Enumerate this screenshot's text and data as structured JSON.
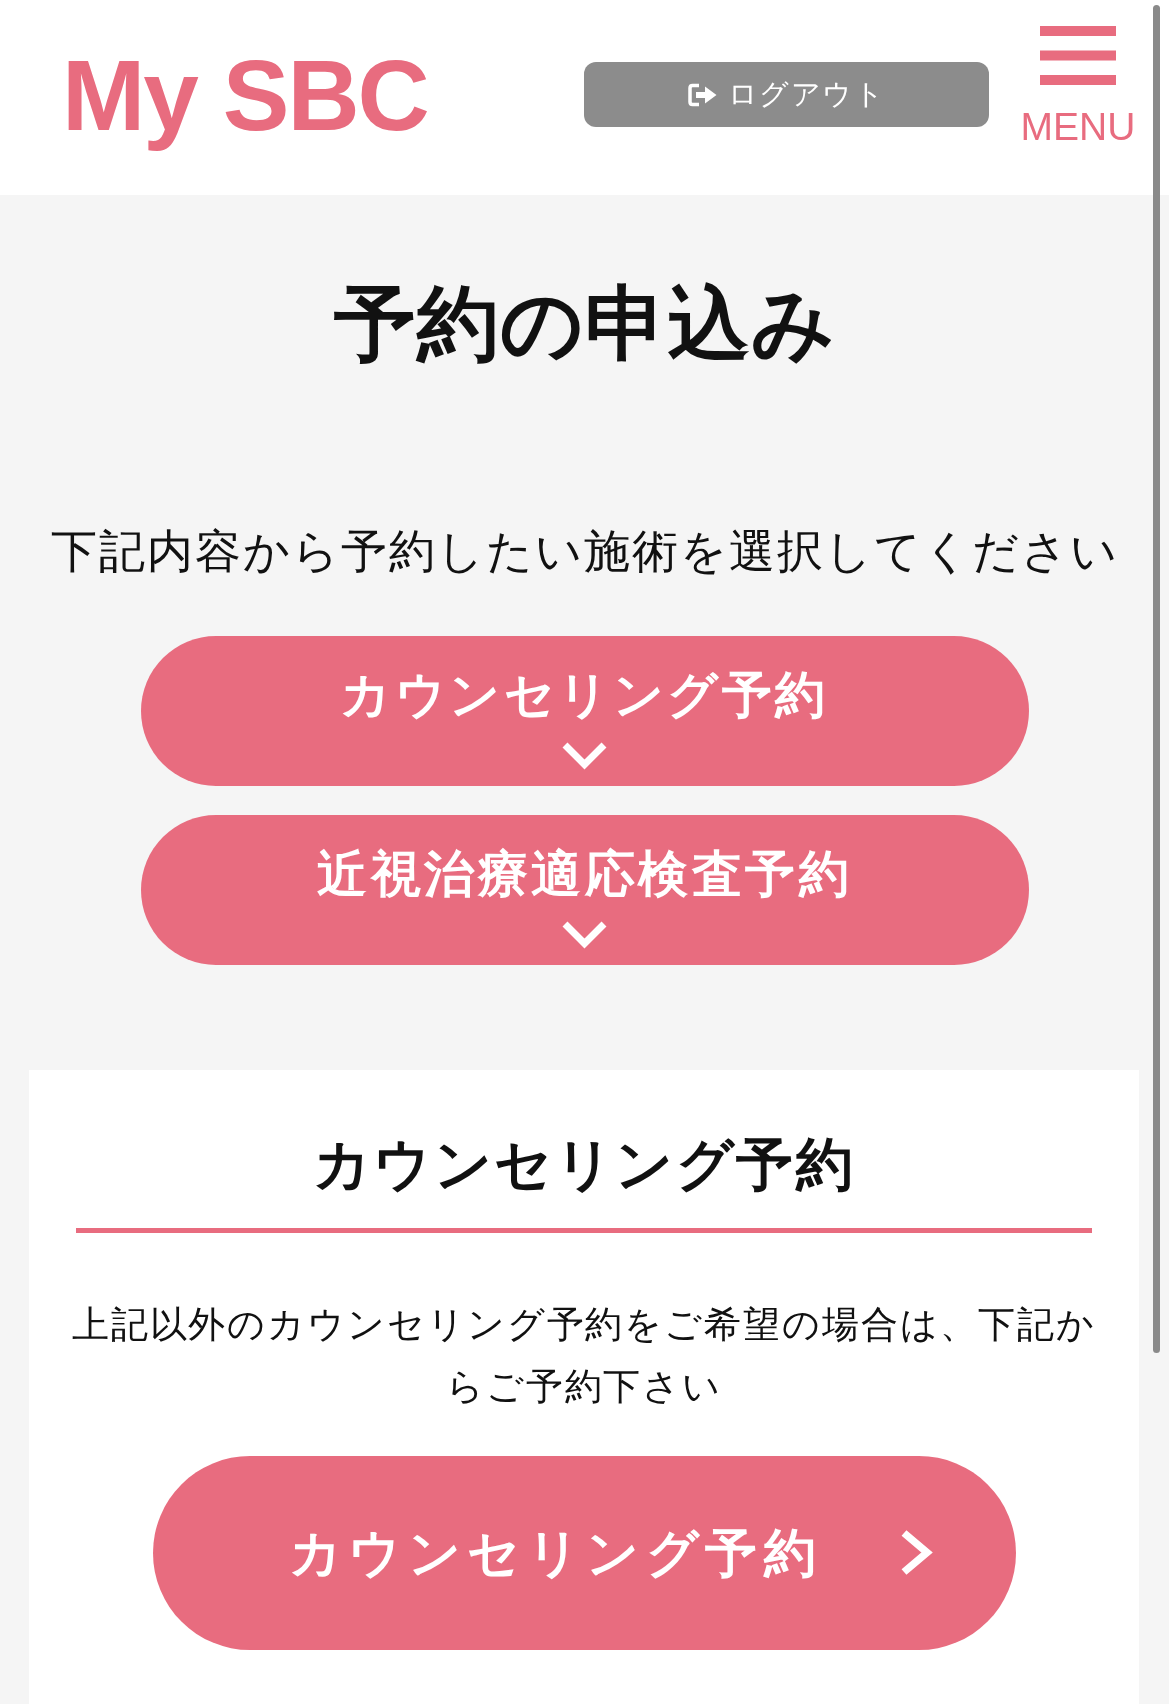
{
  "header": {
    "logo": "My SBC",
    "logout_button": "ログアウト",
    "menu_button": "MENU"
  },
  "page_title": "予約の申込み",
  "instruction": "下記内容から予約したい施術を選択してください",
  "reservation_options": [
    {
      "label": "カウンセリング予約"
    },
    {
      "label": "近視治療適応検査予約"
    }
  ],
  "counseling_section": {
    "heading": "カウンセリング予約",
    "description": "上記以外のカウンセリング予約をご希望の場合は、下記からご予約下さい",
    "button": "カウンセリング予約"
  }
}
